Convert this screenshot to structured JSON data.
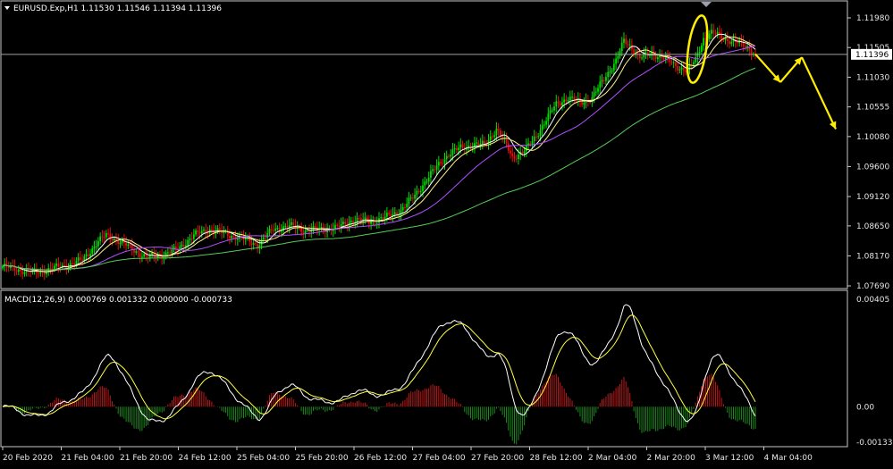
{
  "window": {
    "symbol_header": "EURUSD.Exp,H1  1.11530 1.11546 1.11394 1.11396",
    "current_price_label": "1.11396",
    "macd_header": "MACD(12,26,9) 0.000769 0.001332 0.000000 -0.000733"
  },
  "colors": {
    "background": "#000000",
    "bull_candle": "#00dd00",
    "bear_candle": "#e01010",
    "ma_fast": "#ffffff",
    "ma_mid": "#fff28a",
    "ma_slow_purple": "#b050ff",
    "ma_slow_green": "#55cc55",
    "macd_line": "#ffffff",
    "signal_line": "#ffff44",
    "annotation": "#ffee00"
  },
  "chart_data": [
    {
      "type": "candlestick",
      "title": "EURUSD.Exp,H1",
      "price_axis": [
        "1.11980",
        "1.11505",
        "1.11030",
        "1.10555",
        "1.10080",
        "1.09600",
        "1.09120",
        "1.08650",
        "1.08170",
        "1.07690"
      ],
      "ylim": [
        1.0769,
        1.1198
      ],
      "current_price": 1.11396,
      "x_labels": [
        "20 Feb 2020",
        "21 Feb 04:00",
        "21 Feb 20:00",
        "24 Feb 12:00",
        "25 Feb 04:00",
        "25 Feb 20:00",
        "26 Feb 12:00",
        "27 Feb 04:00",
        "27 Feb 20:00",
        "28 Feb 12:00",
        "2 Mar 04:00",
        "2 Mar 20:00",
        "3 Mar 12:00",
        "4 Mar 04:00"
      ],
      "price_path": [
        [
          0,
          1.08
        ],
        [
          8,
          1.0795
        ],
        [
          16,
          1.079
        ],
        [
          24,
          1.0796
        ],
        [
          32,
          1.0802
        ],
        [
          40,
          1.081
        ],
        [
          48,
          1.084
        ],
        [
          52,
          1.085
        ],
        [
          56,
          1.0845
        ],
        [
          64,
          1.083
        ],
        [
          72,
          1.0815
        ],
        [
          80,
          1.0818
        ],
        [
          88,
          1.0828
        ],
        [
          96,
          1.085
        ],
        [
          104,
          1.086
        ],
        [
          112,
          1.0852
        ],
        [
          120,
          1.0845
        ],
        [
          128,
          1.0835
        ],
        [
          136,
          1.086
        ],
        [
          144,
          1.0865
        ],
        [
          152,
          1.0858
        ],
        [
          160,
          1.086
        ],
        [
          168,
          1.0862
        ],
        [
          176,
          1.0875
        ],
        [
          184,
          1.0872
        ],
        [
          192,
          1.0878
        ],
        [
          200,
          1.089
        ],
        [
          206,
          1.091
        ],
        [
          212,
          1.0935
        ],
        [
          218,
          1.096
        ],
        [
          224,
          1.098
        ],
        [
          230,
          1.099
        ],
        [
          236,
          1.0995
        ],
        [
          242,
          1.0995
        ],
        [
          248,
          1.102
        ],
        [
          252,
          1.1
        ],
        [
          256,
          1.0975
        ],
        [
          262,
          1.0985
        ],
        [
          266,
          1.1
        ],
        [
          272,
          1.103
        ],
        [
          278,
          1.106
        ],
        [
          284,
          1.107
        ],
        [
          290,
          1.1062
        ],
        [
          296,
          1.107
        ],
        [
          302,
          1.11
        ],
        [
          308,
          1.113
        ],
        [
          312,
          1.116
        ],
        [
          316,
          1.115
        ],
        [
          320,
          1.1135
        ],
        [
          326,
          1.114
        ],
        [
          332,
          1.1135
        ],
        [
          338,
          1.112
        ],
        [
          344,
          1.1115
        ],
        [
          348,
          1.113
        ],
        [
          352,
          1.1165
        ],
        [
          356,
          1.1175
        ],
        [
          362,
          1.1165
        ],
        [
          368,
          1.116
        ],
        [
          374,
          1.115
        ],
        [
          378,
          1.114
        ]
      ],
      "moving_averages": [
        {
          "key": "ma_fast",
          "period": 8
        },
        {
          "key": "ma_mid",
          "period": 14
        },
        {
          "key": "ma_slow_purple",
          "period": 36
        },
        {
          "key": "ma_slow_green",
          "period": 110
        }
      ]
    },
    {
      "type": "macd",
      "title": "MACD(12,26,9)",
      "value_axis": [
        "0.00405",
        "0.00",
        "-0.001337"
      ],
      "ylim": [
        -0.001337,
        0.00405
      ],
      "macd": 0.000769,
      "signal": 0.001332,
      "histogram_last": -0.000733
    }
  ],
  "annotations": {
    "forecast_path": [
      [
        1.114,
        0
      ],
      [
        1.1095,
        28
      ],
      [
        1.1135,
        52
      ],
      [
        1.102,
        90
      ]
    ],
    "highlight": "ellipse-around-peak"
  }
}
